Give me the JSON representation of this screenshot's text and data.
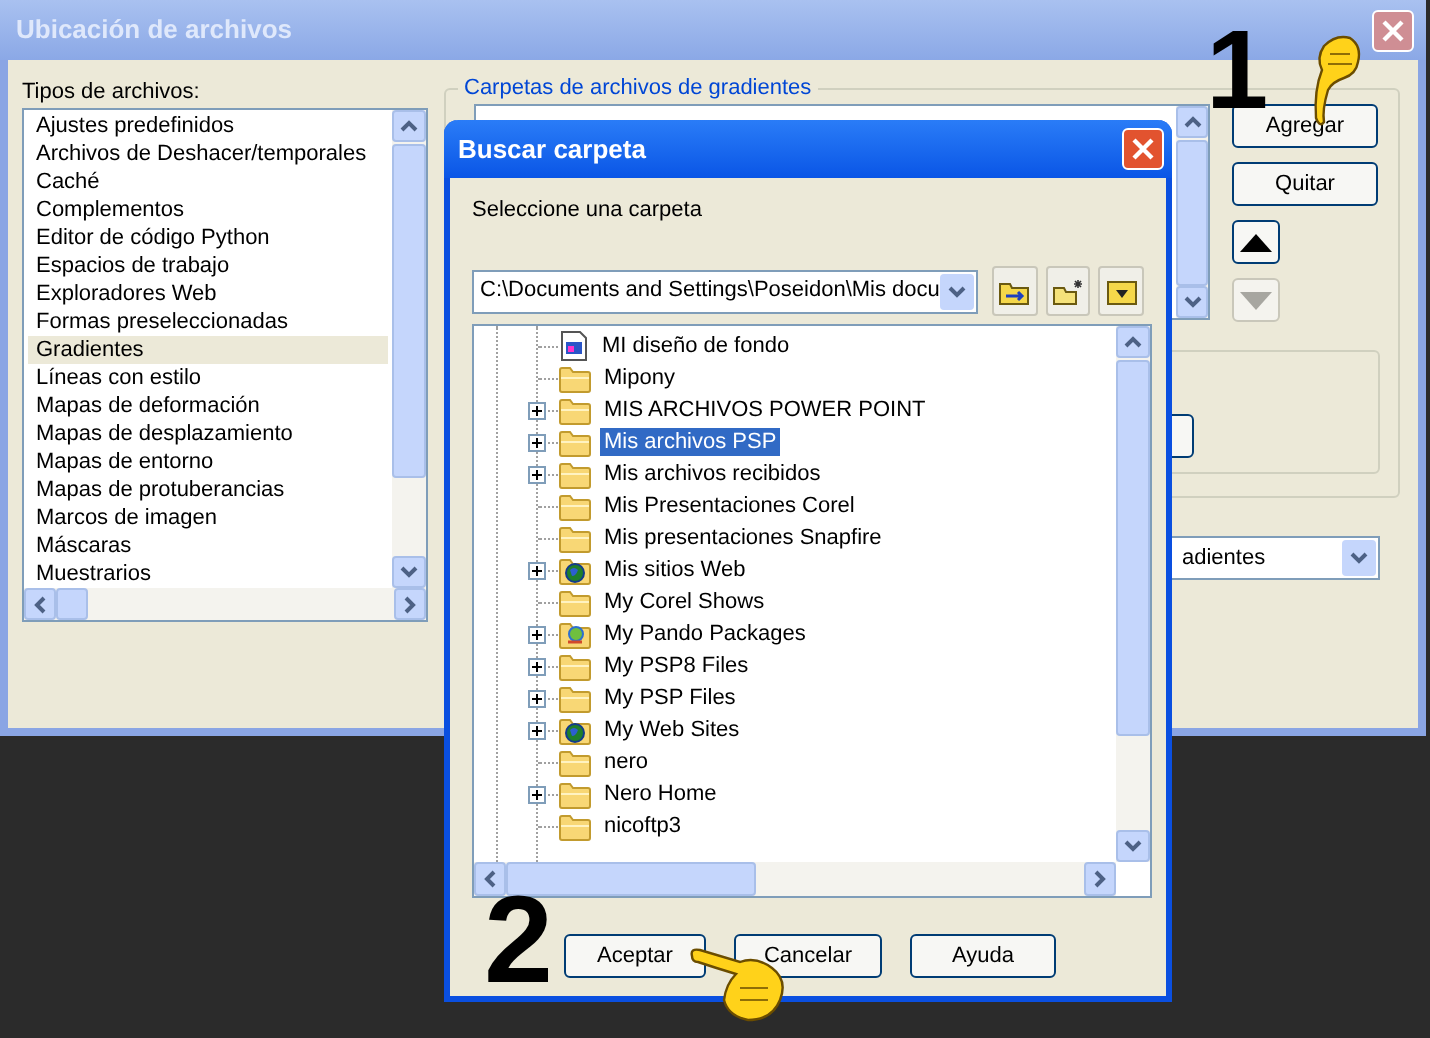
{
  "window": {
    "title": "Ubicación de archivos"
  },
  "file_types": {
    "label": "Tipos de archivos:",
    "items": [
      {
        "label": "Ajustes predefinidos",
        "selected": false
      },
      {
        "label": "Archivos de Deshacer/temporales",
        "selected": false
      },
      {
        "label": "Caché",
        "selected": false
      },
      {
        "label": "Complementos",
        "selected": false
      },
      {
        "label": "Editor de código Python",
        "selected": false
      },
      {
        "label": "Espacios de trabajo",
        "selected": false
      },
      {
        "label": "Exploradores Web",
        "selected": false
      },
      {
        "label": "Formas preseleccionadas",
        "selected": false
      },
      {
        "label": "Gradientes",
        "selected": true
      },
      {
        "label": "Líneas con estilo",
        "selected": false
      },
      {
        "label": "Mapas de deformación",
        "selected": false
      },
      {
        "label": "Mapas de desplazamiento",
        "selected": false
      },
      {
        "label": "Mapas de entorno",
        "selected": false
      },
      {
        "label": "Mapas de protuberancias",
        "selected": false
      },
      {
        "label": "Marcos de imagen",
        "selected": false
      },
      {
        "label": "Máscaras",
        "selected": false
      },
      {
        "label": "Muestrarios",
        "selected": false
      }
    ]
  },
  "folders_group": {
    "title": "Carpetas de archivos de gradientes",
    "buttons": [
      {
        "label": "Agregar"
      },
      {
        "label": "Quitar"
      }
    ],
    "move_up": {
      "disabled": false
    },
    "move_down": {
      "disabled": true
    }
  },
  "combo": {
    "value": "adientes"
  },
  "dialog": {
    "title": "Buscar carpeta",
    "prompt": "Seleccione una carpeta",
    "path": "C:\\Documents and Settings\\Poseidon\\Mis docu",
    "tree": [
      {
        "label": "MI diseño de fondo",
        "kind": "document",
        "expander": false,
        "selected": false
      },
      {
        "label": "Mipony",
        "kind": "folder",
        "expander": false,
        "selected": false
      },
      {
        "label": "MIS ARCHIVOS POWER POINT",
        "kind": "folder",
        "expander": true,
        "selected": false
      },
      {
        "label": "Mis archivos PSP",
        "kind": "folder",
        "expander": true,
        "selected": true
      },
      {
        "label": "Mis archivos recibidos",
        "kind": "folder",
        "expander": true,
        "selected": false
      },
      {
        "label": "Mis Presentaciones Corel",
        "kind": "folder",
        "expander": false,
        "selected": false
      },
      {
        "label": "Mis presentaciones Snapfire",
        "kind": "folder",
        "expander": false,
        "selected": false
      },
      {
        "label": "Mis sitios Web",
        "kind": "web-folder",
        "expander": true,
        "selected": false
      },
      {
        "label": "My Corel Shows",
        "kind": "folder",
        "expander": false,
        "selected": false
      },
      {
        "label": "My Pando Packages",
        "kind": "package",
        "expander": true,
        "selected": false
      },
      {
        "label": "My PSP8 Files",
        "kind": "folder",
        "expander": true,
        "selected": false
      },
      {
        "label": "My PSP Files",
        "kind": "folder",
        "expander": true,
        "selected": false
      },
      {
        "label": "My Web Sites",
        "kind": "web-folder",
        "expander": true,
        "selected": false
      },
      {
        "label": "nero",
        "kind": "folder",
        "expander": false,
        "selected": false
      },
      {
        "label": "Nero Home",
        "kind": "folder",
        "expander": true,
        "selected": false
      },
      {
        "label": "nicoftp3",
        "kind": "folder",
        "expander": false,
        "selected": false
      }
    ],
    "buttons": [
      {
        "label": "Aceptar"
      },
      {
        "label": "Cancelar"
      },
      {
        "label": "Ayuda"
      }
    ]
  },
  "annotations": [
    {
      "label": "1"
    },
    {
      "label": "2"
    }
  ]
}
